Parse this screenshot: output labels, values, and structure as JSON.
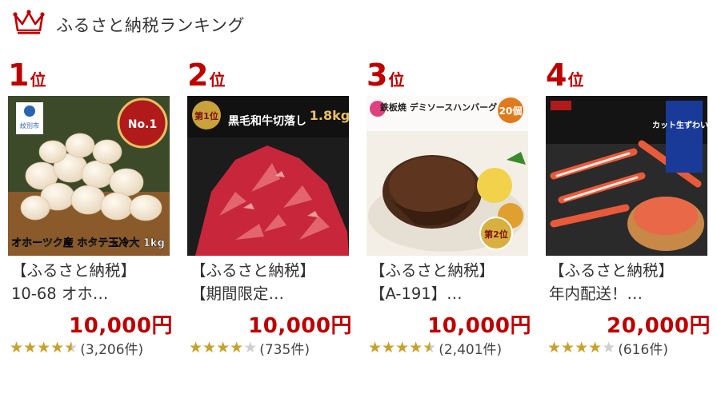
{
  "header": {
    "title": "ふるさと納税ランキング",
    "crown_icon": "crown-icon",
    "accent": "#bf0000"
  },
  "items": [
    {
      "rank_num": "1",
      "rank_unit": "位",
      "title_line1": "【ふるさと納税】",
      "title_line2": "10-68 オホ…",
      "price": "10,000円",
      "rating": 4.5,
      "review_count": "(3,206件)",
      "image_text_top": "No.1",
      "image_text_bottom": "オホーツク産 ホタテ玉冷大 1kg",
      "image_badge": "紋別市"
    },
    {
      "rank_num": "2",
      "rank_unit": "位",
      "title_line1": "【ふるさと納税】",
      "title_line2": "【期間限定…",
      "price": "10,000円",
      "rating": 4.0,
      "review_count": "(735件)",
      "image_text_top": "黒毛和牛切落し",
      "image_text_bottom": "1.8kg",
      "image_badge": "第1位"
    },
    {
      "rank_num": "3",
      "rank_unit": "位",
      "title_line1": "【ふるさと納税】",
      "title_line2": "【A-191】…",
      "price": "10,000円",
      "rating": 4.5,
      "review_count": "(2,401件)",
      "image_text_top": "鉄板焼 デミソースハンバーグ",
      "image_text_bottom": "20個",
      "image_badge": "第2位"
    },
    {
      "rank_num": "4",
      "rank_unit": "位",
      "title_line1": "【ふるさと納税】",
      "title_line2": "年内配送！…",
      "price": "20,000円",
      "rating": 4.0,
      "review_count": "(616件)",
      "image_text_top": "カット生ずわい蟹",
      "image_text_bottom": "",
      "image_badge": ""
    }
  ],
  "colors": {
    "rank": "#bf0000",
    "price": "#bf0000",
    "star": "#c8a02c",
    "star_empty": "#cfcfcf"
  }
}
